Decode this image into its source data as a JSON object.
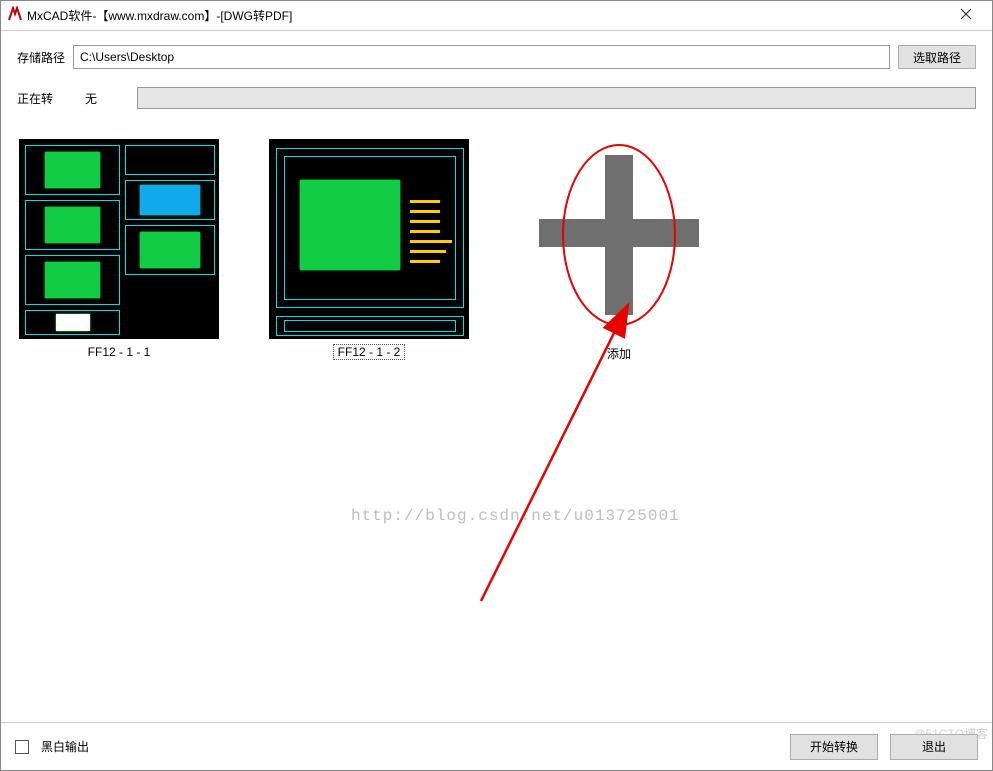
{
  "window": {
    "title": "MxCAD软件-【www.mxdraw.com】-[DWG转PDF]"
  },
  "header": {
    "storage_path_label": "存储路径",
    "path_value": "C:\\Users\\Desktop",
    "browse_button_label": "选取路径",
    "converting_label": "正在转",
    "converting_value": "无"
  },
  "thumbs": [
    {
      "label": "FF12 - 1 - 1"
    },
    {
      "label": "FF12 - 1 - 2"
    }
  ],
  "add_tile_label": "添加",
  "watermark_text": "http://blog.csdn.net/u013725001",
  "corner_watermark": "@51CTO博客",
  "footer": {
    "bw_output_label": "黑白输出",
    "start_button_label": "开始转换",
    "exit_button_label": "退出"
  }
}
